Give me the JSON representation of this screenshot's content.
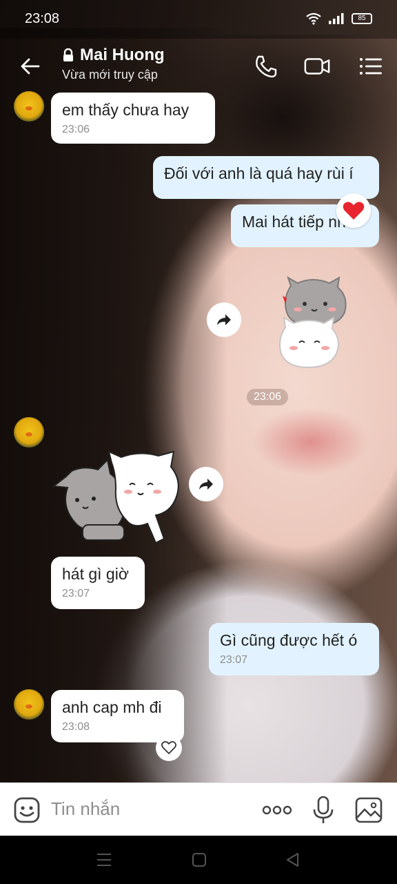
{
  "status_bar": {
    "time": "23:08",
    "battery": "85"
  },
  "header": {
    "contact_name": "Mai Huong",
    "status": "Vừa mới truy cập"
  },
  "messages": [
    {
      "direction": "in",
      "text": "em thấy chưa hay",
      "time": "23:06"
    },
    {
      "direction": "out",
      "text": "Đối với anh là quá hay rùi í"
    },
    {
      "direction": "out",
      "text": "Mai hát tiếp nhớ",
      "reaction": "heart"
    },
    {
      "direction": "out",
      "type": "sticker",
      "sticker": "cats-hugging"
    },
    {
      "type": "time-separator",
      "text": "23:06"
    },
    {
      "direction": "in",
      "type": "sticker",
      "sticker": "cats-hugging"
    },
    {
      "direction": "in",
      "text": "hát gì giờ",
      "time": "23:07"
    },
    {
      "direction": "out",
      "text": "Gì cũng được hết ó",
      "time": "23:07"
    },
    {
      "direction": "in",
      "text": "anh cap mh đi",
      "time": "23:08"
    }
  ],
  "input": {
    "placeholder": "Tin nhắn"
  },
  "icons": {
    "back": "arrow-left-icon",
    "lock": "lock-icon",
    "call": "phone-icon",
    "video": "video-camera-icon",
    "menu": "list-menu-icon",
    "sticker": "smiley-icon",
    "more": "more-dots-icon",
    "mic": "microphone-icon",
    "image": "image-icon"
  },
  "colors": {
    "outgoing_bubble": "#e2f3ff",
    "incoming_bubble": "#ffffff",
    "reaction_heart": "#e8252f"
  }
}
